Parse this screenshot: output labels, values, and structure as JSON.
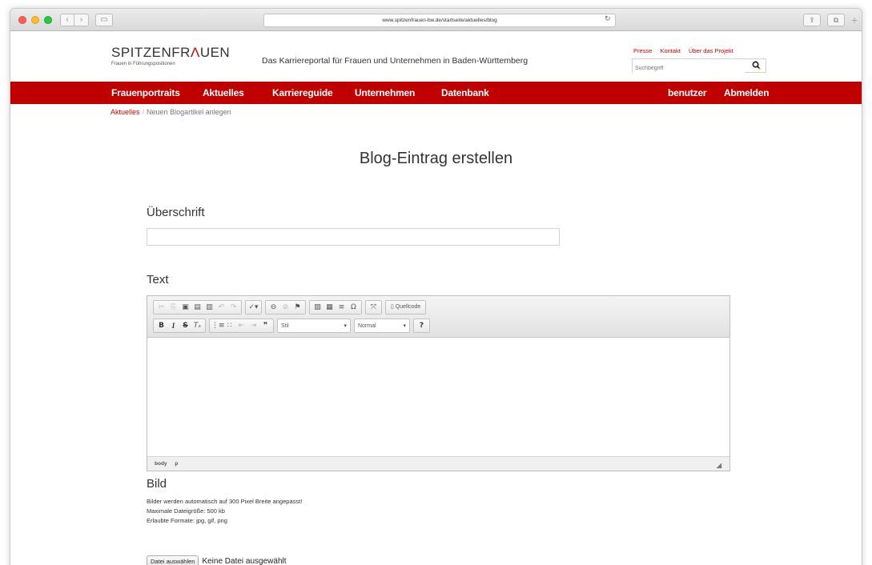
{
  "browser": {
    "url": "www.spitzenfrauen-bw.de/startseite/aktuelles/blog"
  },
  "header": {
    "logo_prefix": "SPITZENFR",
    "logo_accent": "Λ",
    "logo_suffix": "UEN",
    "logo_subtitle": "Frauen in Führungspositionen",
    "tagline": "Das Karriereportal für Frauen und Unternehmen in Baden-Württemberg",
    "top_links": [
      "Presse",
      "Kontakt",
      "Über das Projekt"
    ],
    "search_placeholder": "Suchbegriff"
  },
  "nav": {
    "items": [
      "Frauenportraits",
      "Aktuelles",
      "Karriereguide",
      "Unternehmen",
      "Datenbank"
    ],
    "user": "benutzer",
    "logout": "Abmelden"
  },
  "breadcrumb": {
    "parent": "Aktuelles",
    "separator": "/",
    "current": "Neuen Blogartikel anlegen"
  },
  "form": {
    "title": "Blog-Eintrag erstellen",
    "heading_label": "Überschrift",
    "heading_value": "",
    "text_label": "Text",
    "image_label": "Bild",
    "image_help": [
      "Bilder werden automatisch auf 300 Pixel Breite angepasst!",
      "Maximale Dateigröße: 500 kb",
      "Erlaubte Formate: jpg, gif, png"
    ],
    "file_button": "Datei auswählen",
    "file_status": "Keine Datei ausgewählt"
  },
  "editor": {
    "source_button": "Quellcode",
    "style_select": "Stil",
    "format_select": "Normal",
    "help_button": "?",
    "status_path": [
      "body",
      "p"
    ]
  },
  "colors": {
    "brand_red": "#c00000",
    "link_red": "#cc0000"
  }
}
